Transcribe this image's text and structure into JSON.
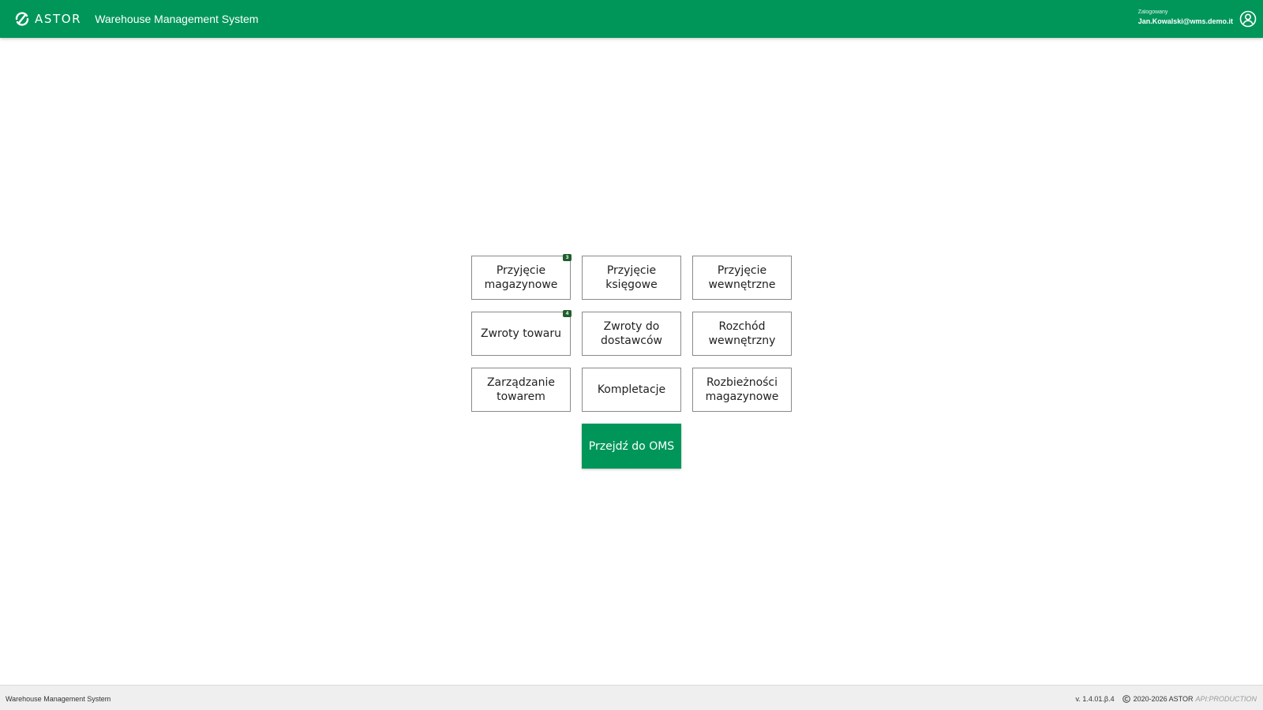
{
  "header": {
    "logo_text": "ASTOR",
    "app_title": "Warehouse Management System",
    "user_label": "Zalogowany",
    "user_email": "Jan.Kowalski@wms.demo.it",
    "accent_color": "#00965a"
  },
  "tiles": [
    {
      "label": "Przyjęcie magazynowe",
      "badge": "3"
    },
    {
      "label": "Przyjęcie księgowe",
      "badge": null
    },
    {
      "label": "Przyjęcie wewnętrzne",
      "badge": null
    },
    {
      "label": "Zwroty towaru",
      "badge": "4"
    },
    {
      "label": "Zwroty do dostawców",
      "badge": null
    },
    {
      "label": "Rozchód wewnętrzny",
      "badge": null
    },
    {
      "label": "Zarządzanie towarem",
      "badge": null
    },
    {
      "label": "Kompletacje",
      "badge": null
    },
    {
      "label": "Rozbieżności magazynowe",
      "badge": null
    }
  ],
  "oms_button": {
    "label": "Przejdź do OMS"
  },
  "footer": {
    "app_name": "Warehouse Management System",
    "version": "v. 1.4.01.β.4",
    "copyright": "2020-2026 ASTOR",
    "environment": "API:PRODUCTION"
  },
  "icons": {
    "logo": "astor-logo-icon",
    "user": "user-circle-icon",
    "copyright": "copyright-icon"
  }
}
